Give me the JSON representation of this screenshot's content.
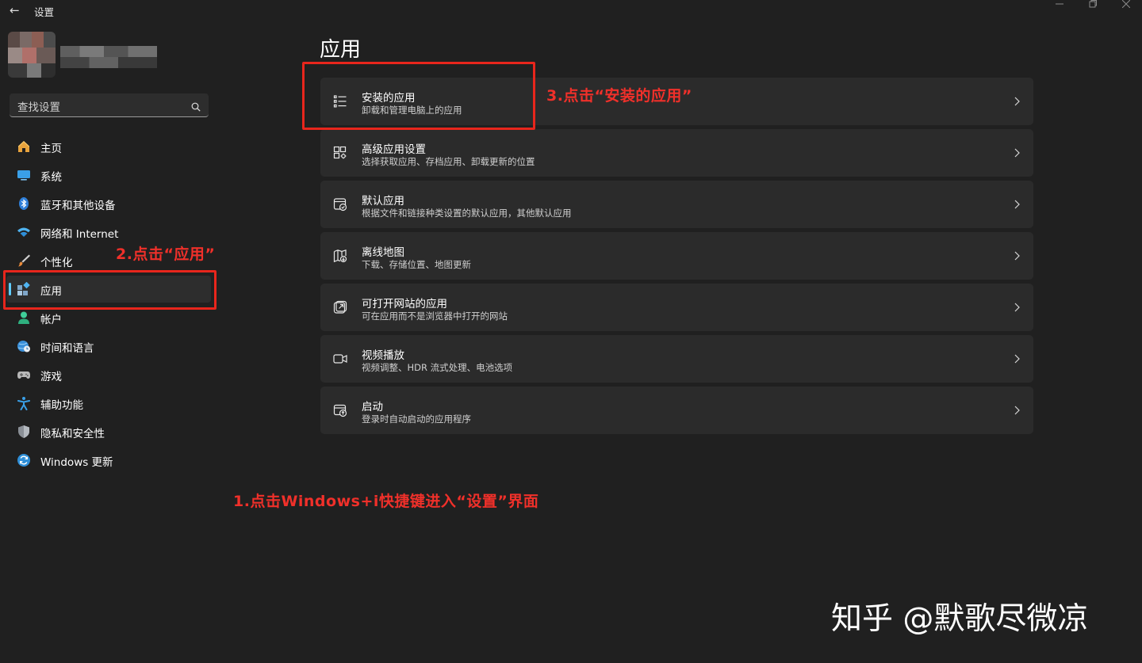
{
  "window": {
    "title": "设置",
    "back_glyph": "←",
    "controls": [
      "minimize-icon",
      "restore-icon",
      "close-icon"
    ]
  },
  "search": {
    "placeholder": "查找设置"
  },
  "sidebar": {
    "items": [
      {
        "label": "主页",
        "icon": "home-icon"
      },
      {
        "label": "系统",
        "icon": "monitor-icon"
      },
      {
        "label": "蓝牙和其他设备",
        "icon": "bluetooth-icon"
      },
      {
        "label": "网络和 Internet",
        "icon": "wifi-icon"
      },
      {
        "label": "个性化",
        "icon": "brush-icon"
      },
      {
        "label": "应用",
        "icon": "apps-icon",
        "selected": true
      },
      {
        "label": "帐户",
        "icon": "account-icon"
      },
      {
        "label": "时间和语言",
        "icon": "globe-clock-icon"
      },
      {
        "label": "游戏",
        "icon": "gamepad-icon"
      },
      {
        "label": "辅助功能",
        "icon": "accessibility-icon"
      },
      {
        "label": "隐私和安全性",
        "icon": "shield-icon"
      },
      {
        "label": "Windows 更新",
        "icon": "update-icon"
      }
    ]
  },
  "main": {
    "title": "应用",
    "cards": [
      {
        "title": "安装的应用",
        "subtitle": "卸载和管理电脑上的应用",
        "icon": "list-icon"
      },
      {
        "title": "高级应用设置",
        "subtitle": "选择获取应用、存档应用、卸载更新的位置",
        "icon": "app-gear-icon"
      },
      {
        "title": "默认应用",
        "subtitle": "根据文件和链接种类设置的默认应用，其他默认应用",
        "icon": "default-app-icon"
      },
      {
        "title": "离线地图",
        "subtitle": "下载、存储位置、地图更新",
        "icon": "map-icon"
      },
      {
        "title": "可打开网站的应用",
        "subtitle": "可在应用而不是浏览器中打开的网站",
        "icon": "open-external-icon"
      },
      {
        "title": "视频播放",
        "subtitle": "视频调整、HDR 流式处理、电池选项",
        "icon": "video-icon"
      },
      {
        "title": "启动",
        "subtitle": "登录时自动启动的应用程序",
        "icon": "startup-icon"
      }
    ]
  },
  "annotations": {
    "step1": "1.点击Windows+i快捷键进入“设置”界面",
    "step2": "2.点击“应用”",
    "step3": "3.点击“安装的应用”",
    "color": "#e8261c"
  },
  "watermark": "知乎 @默歌尽微凉",
  "colors": {
    "accent": "#60cdff",
    "background": "#202020",
    "card": "#2b2b2b"
  }
}
